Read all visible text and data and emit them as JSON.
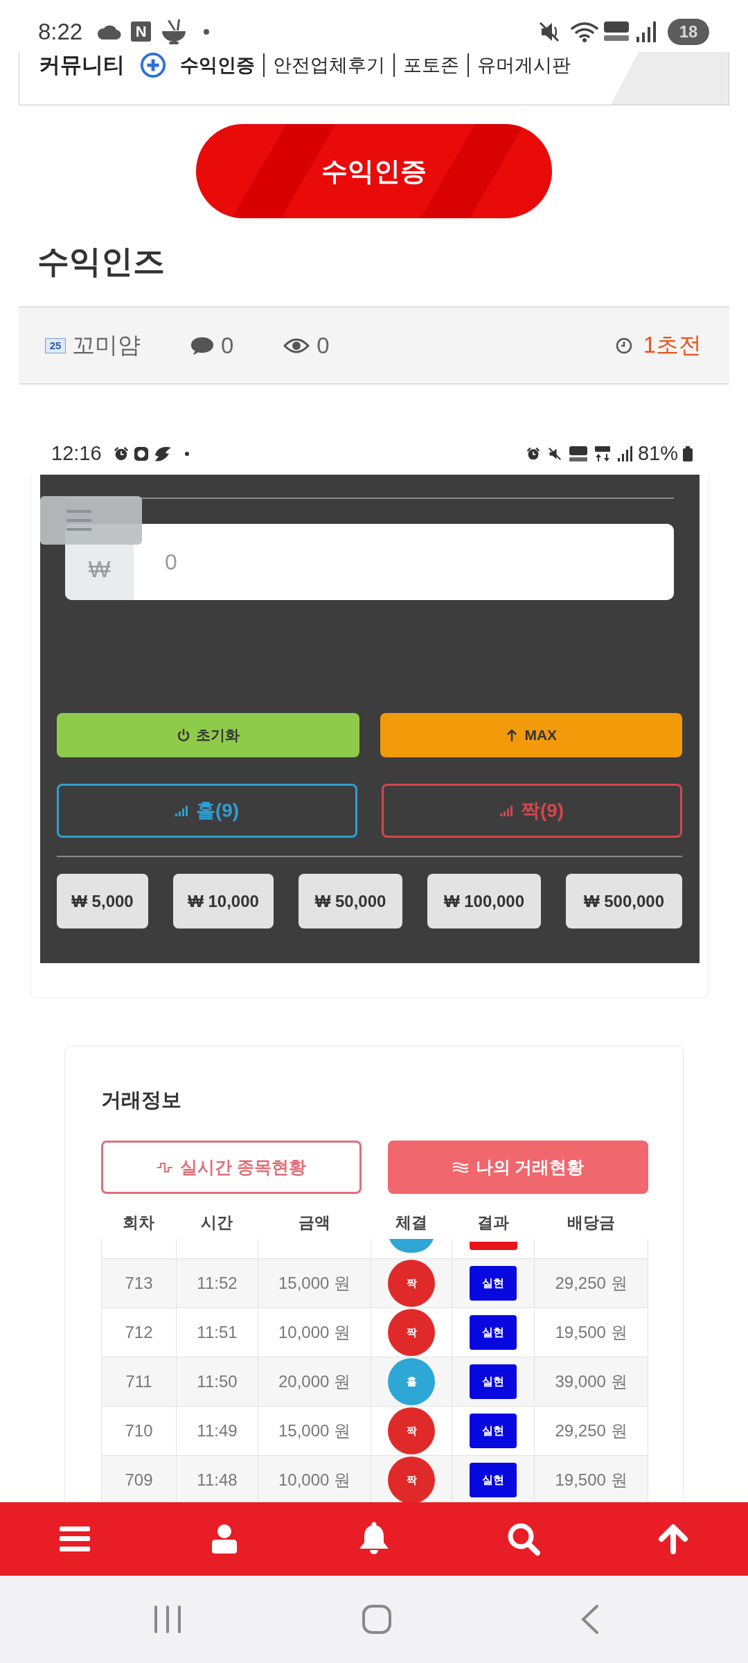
{
  "status_bar": {
    "time": "8:22",
    "app_badge": "N",
    "battery": "18"
  },
  "board_nav": {
    "label": "커뮤니티",
    "links": [
      {
        "label": "수익인증",
        "selected": true
      },
      {
        "label": "안전업체후기",
        "selected": false
      },
      {
        "label": "포토존",
        "selected": false
      },
      {
        "label": "유머게시판",
        "selected": false
      }
    ]
  },
  "category_button": {
    "label": "수익인증"
  },
  "post": {
    "title": "수익인즈",
    "author_badge": "25",
    "author": "꼬미얌",
    "comments": "0",
    "views": "0",
    "posted": "1초전"
  },
  "post_image": {
    "status_bar": {
      "time": "12:16",
      "battery": "81%"
    },
    "amount_field": {
      "currency": "₩",
      "value": "0"
    },
    "actions": [
      {
        "kind": "reset",
        "label": "초기화"
      },
      {
        "kind": "max",
        "label": "MAX"
      }
    ],
    "picks": [
      {
        "label": "홀(9)",
        "color": "#2e9fd4"
      },
      {
        "label": "짝(9)",
        "color": "#d4464e"
      }
    ],
    "chips": [
      "₩ 5,000",
      "₩ 10,000",
      "₩ 50,000",
      "₩ 100,000",
      "₩ 500,000"
    ]
  },
  "trade_info": {
    "title": "거래정보",
    "tabs": [
      {
        "kind": "live",
        "label": "실시간 종목현황",
        "selected": false
      },
      {
        "kind": "mine",
        "label": "나의 거래현황",
        "selected": true
      }
    ],
    "table": {
      "columns": [
        "회차",
        "시간",
        "금액",
        "체결",
        "결과",
        "배당금"
      ],
      "cut_row": {
        "pick": {
          "color": "#2ea6d6"
        },
        "result": {
          "color": "#e8141b"
        }
      },
      "rows": [
        {
          "round": "713",
          "time": "11:52",
          "amount": "15,000 원",
          "pick": {
            "label": "짝",
            "color": "#e02a2a"
          },
          "result": {
            "label": "실현",
            "color": "#0808e0"
          },
          "payout": "29,250 원"
        },
        {
          "round": "712",
          "time": "11:51",
          "amount": "10,000 원",
          "pick": {
            "label": "짝",
            "color": "#e02a2a"
          },
          "result": {
            "label": "실현",
            "color": "#0808e0"
          },
          "payout": "19,500 원"
        },
        {
          "round": "711",
          "time": "11:50",
          "amount": "20,000 원",
          "pick": {
            "label": "홀",
            "color": "#2ea6d6"
          },
          "result": {
            "label": "실현",
            "color": "#0808e0"
          },
          "payout": "39,000 원"
        },
        {
          "round": "710",
          "time": "11:49",
          "amount": "15,000 원",
          "pick": {
            "label": "짝",
            "color": "#e02a2a"
          },
          "result": {
            "label": "실현",
            "color": "#0808e0"
          },
          "payout": "29,250 원"
        },
        {
          "round": "709",
          "time": "11:48",
          "amount": "10,000 원",
          "pick": {
            "label": "짝",
            "color": "#e02a2a"
          },
          "result": {
            "label": "실현",
            "color": "#0808e0"
          },
          "payout": "19,500 원"
        }
      ]
    }
  }
}
